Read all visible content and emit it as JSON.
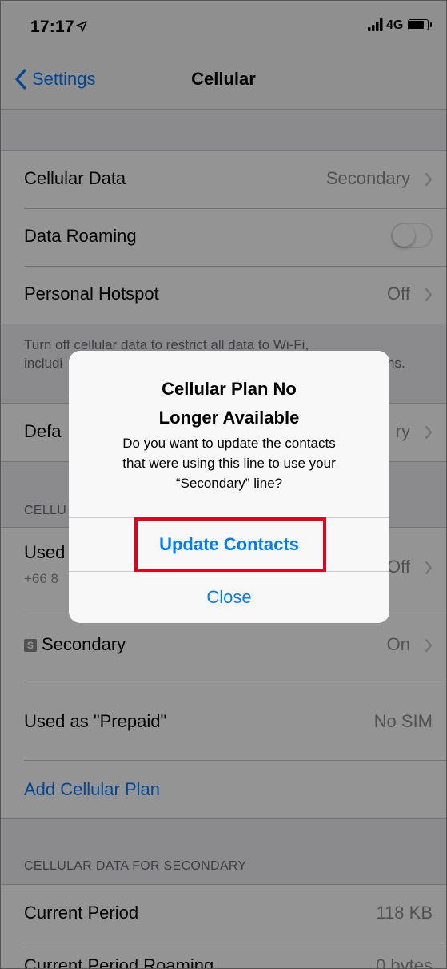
{
  "status_bar": {
    "time": "17:17",
    "network": "4G",
    "battery_level": 0.8
  },
  "nav": {
    "back_label": "Settings",
    "title": "Cellular"
  },
  "settings": {
    "cellular_data": {
      "label": "Cellular Data",
      "value": "Secondary"
    },
    "data_roaming": {
      "label": "Data Roaming",
      "enabled": false
    },
    "personal_hotspot": {
      "label": "Personal Hotspot",
      "value": "Off"
    },
    "footer_line1": "Turn off cellular data to restrict all data to Wi-Fi,",
    "footer_line2_start": "includi",
    "footer_line2_end": "ns.",
    "default_line": {
      "label_partial": "Defa",
      "value_partial": "ry"
    },
    "cellular_plans_header_partial": "CELLU",
    "used_line": {
      "label_partial": "Used",
      "sub_partial": "+66 8",
      "value_partial": "Off"
    },
    "secondary": {
      "badge": "S",
      "label": "Secondary",
      "value": "On"
    },
    "prepaid": {
      "label": "Used as \"Prepaid\"",
      "value": "No SIM"
    },
    "add_plan": "Add Cellular Plan",
    "data_section_header": "CELLULAR DATA FOR SECONDARY",
    "current_period": {
      "label": "Current Period",
      "value": "118 KB"
    },
    "current_period_roaming": {
      "label": "Current Period Roaming",
      "value": "0 bytes"
    }
  },
  "alert": {
    "title_line1": "Cellular Plan No",
    "title_line2": "Longer Available",
    "message_line1": "Do you want to update the contacts",
    "message_line2": "that were using this line to use your",
    "message_line3": "“Secondary” line?",
    "primary_button": "Update Contacts",
    "secondary_button": "Close"
  },
  "colors": {
    "accent": "#007aff",
    "highlight": "#e2001a",
    "background": "#efeff4"
  }
}
